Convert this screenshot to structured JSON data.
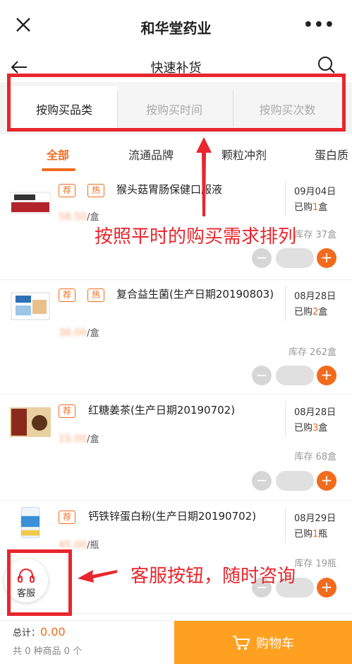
{
  "window": {
    "title": "和华堂药业"
  },
  "nav": {
    "title": "快速补货"
  },
  "sort_tabs": [
    {
      "label": "按购买品类"
    },
    {
      "label": "按购买时间"
    },
    {
      "label": "按购买次数"
    }
  ],
  "categories": [
    {
      "label": "全部"
    },
    {
      "label": "流通品牌"
    },
    {
      "label": "颗粒冲剂"
    },
    {
      "label": "蛋白质"
    }
  ],
  "products": [
    {
      "tags": [
        "荐",
        "热"
      ],
      "name": "猴头菇胃肠保健口服液",
      "price": "58.50",
      "unit": "/盒",
      "date": "09月04日",
      "bought_prefix": "已购",
      "bought_num": "1",
      "bought_unit": "盒",
      "stock": "库存 37盒"
    },
    {
      "tags": [
        "荐",
        "热"
      ],
      "name": "复合益生菌(生产日期20190803)",
      "price": "36.00",
      "unit": "/盒",
      "date": "08月28日",
      "bought_prefix": "已购",
      "bought_num": "2",
      "bought_unit": "盒",
      "stock": "库存 262盒"
    },
    {
      "tags": [
        "荐"
      ],
      "name": "红糖姜茶(生产日期20190702)",
      "price": "15.00",
      "unit": "/盒",
      "date": "08月28日",
      "bought_prefix": "已购",
      "bought_num": "3",
      "bought_unit": "盒",
      "stock": "库存 68盒"
    },
    {
      "tags": [
        "荐"
      ],
      "name": "钙铁锌蛋白粉(生产日期20190702)",
      "price": "45.00",
      "unit": "/瓶",
      "date": "08月29日",
      "bought_prefix": "已购",
      "bought_num": "1",
      "bought_unit": "瓶",
      "stock": "库存 19瓶"
    }
  ],
  "annotations": {
    "sort_note": "按照平时的购买需求排列",
    "service_note": "客服按钮，随时咨询"
  },
  "service": {
    "label": "客服"
  },
  "footer": {
    "total_label": "总计：",
    "total_value": "0.00",
    "count_text": "共 0 种商品 0 个",
    "cart_label": "购物车"
  },
  "colors": {
    "accent": "#f26b1d",
    "cart": "#ffa020",
    "annotation": "#e8262d"
  }
}
